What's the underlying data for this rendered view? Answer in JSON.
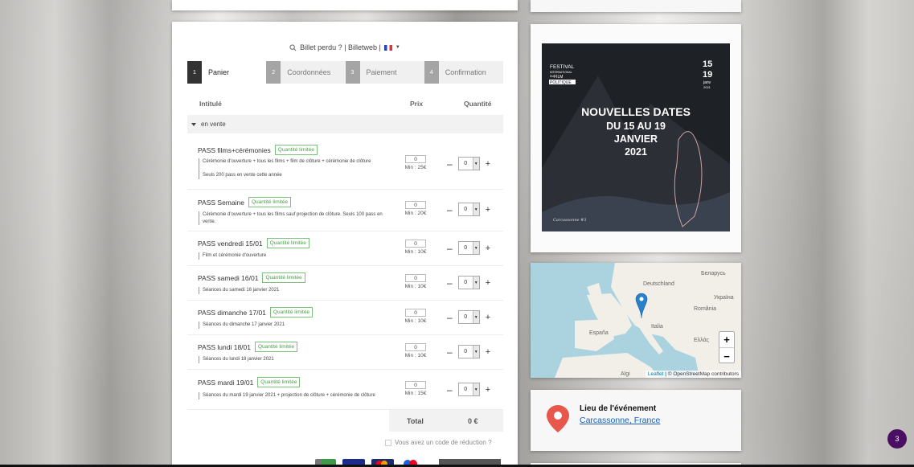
{
  "links": {
    "text": "Billet perdu ? | Billetweb |"
  },
  "steps": [
    {
      "num": "1",
      "label": "Panier"
    },
    {
      "num": "2",
      "label": "Coordonnées"
    },
    {
      "num": "3",
      "label": "Paiement"
    },
    {
      "num": "4",
      "label": "Confirmation"
    }
  ],
  "table": {
    "col_title": "Intitulé",
    "col_price": "Prix",
    "col_qty": "Quantité",
    "category": "en vente"
  },
  "tickets": [
    {
      "title": "PASS films+cérémonies",
      "tag": "Quantité limitée",
      "desc": "Cérémonie d'ouverture + tous les films + film de clôture + cérémonie de clôture",
      "desc2": "Seuls 200 pass en vente cette année",
      "price": "0",
      "min": "Min : 25€",
      "qty": "0"
    },
    {
      "title": "PASS Semaine",
      "tag": "Quantité limitée",
      "desc": "Cérémonie d'ouverture + tous les films sauf projection de clôture. Seuls 100 pass en vente.",
      "desc2": "",
      "price": "0",
      "min": "Min : 20€",
      "qty": "0"
    },
    {
      "title": "PASS vendredi 15/01",
      "tag": "Quantité limitée",
      "desc": "Film et cérémonie d'ouverture",
      "desc2": "",
      "price": "0",
      "min": "Min : 10€",
      "qty": "0"
    },
    {
      "title": "PASS samedi 16/01",
      "tag": "Quantité limitée",
      "desc": "Séances du samedi 16 janvier 2021",
      "desc2": "",
      "price": "0",
      "min": "Min : 10€",
      "qty": "0"
    },
    {
      "title": "PASS dimanche 17/01",
      "tag": "Quantité limitée",
      "desc": "Séances du dimanche 17 janvier 2021",
      "desc2": "",
      "price": "0",
      "min": "Min : 10€",
      "qty": "0"
    },
    {
      "title": "PASS lundi 18/01",
      "tag": "Quantité limitée",
      "desc": "Séances du lundi 18 janvier 2021",
      "desc2": "",
      "price": "0",
      "min": "Min : 10€",
      "qty": "0"
    },
    {
      "title": "PASS mardi 19/01",
      "tag": "Quantité limitée",
      "desc": "Séances du mardi 19 janvier 2021 + projection de clôture + cérémonie de clôture",
      "desc2": "",
      "price": "0",
      "min": "Min : 15€",
      "qty": "0"
    }
  ],
  "total": {
    "label": "Total",
    "value": "0 €"
  },
  "promo": "Vous avez un code de réduction ?",
  "poster": {
    "festival": "FESTIVAL",
    "intl": "INTERNATIONAL",
    "du": "DU",
    "film": "FILM",
    "pol": "POLITIQUE",
    "d1": "15",
    "d2": "19",
    "month": "janv",
    "year": "2021",
    "h1": "NOUVELLES DATES",
    "h2": "DU 15 AU 19",
    "h3": "JANVIER",
    "h4": "2021",
    "edition": "Carcassonne #3"
  },
  "map": {
    "labels": [
      "Deutschland",
      "Беларусь",
      "Україна",
      "România",
      "España",
      "Italia",
      "Ελλάς",
      "Algi"
    ],
    "zoom_in": "+",
    "zoom_out": "−",
    "leaflet": "Leaflet",
    "osm": "© OpenStreetMap contributors"
  },
  "location": {
    "title": "Lieu de l'événement",
    "link": "Carcassonne, France"
  },
  "badge": "3",
  "colors": {
    "accent": "#4a0f63",
    "tag": "#4a9e4a",
    "marker": "#2a81cb",
    "pin": "#e8574c"
  }
}
